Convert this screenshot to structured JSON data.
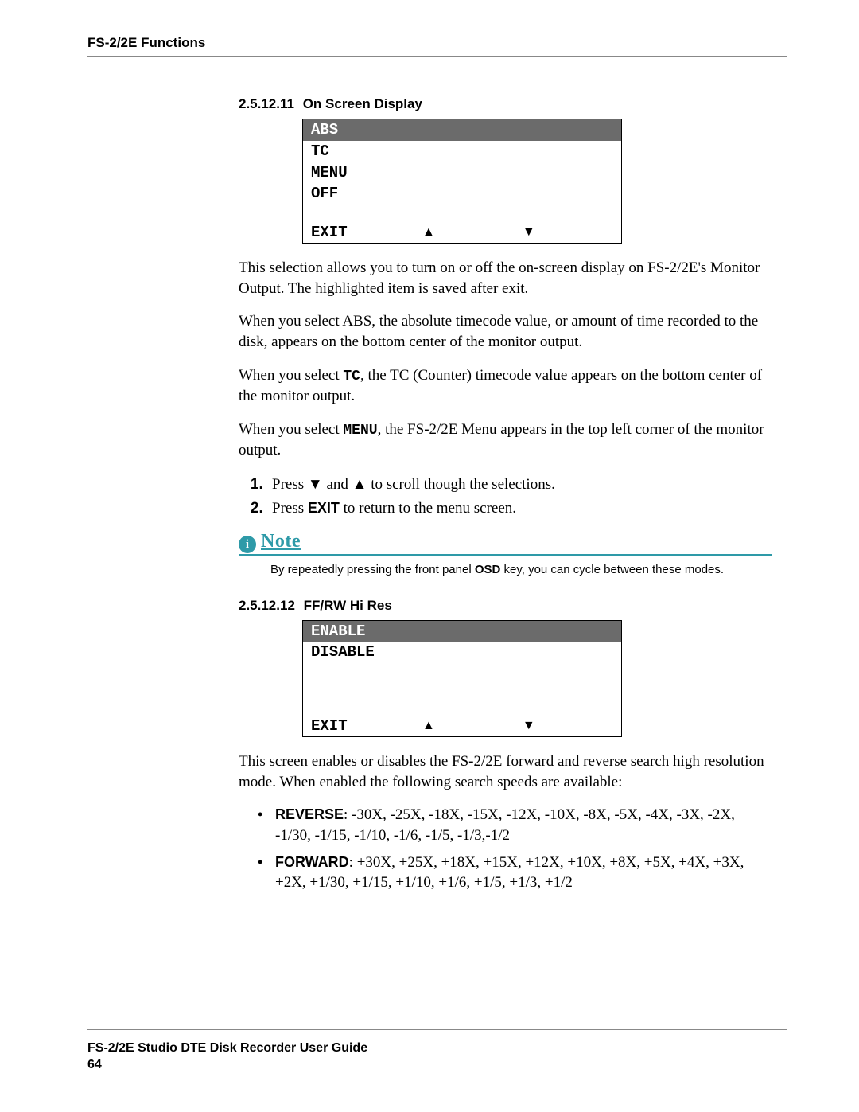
{
  "header": {
    "running_head": "FS-2/2E Functions"
  },
  "section1": {
    "number": "2.5.12.11",
    "title": "On Screen Display",
    "lcd": {
      "rows": [
        "ABS",
        "TC",
        "MENU",
        "OFF"
      ],
      "highlighted_index": 0,
      "exit_label": "EXIT",
      "arrow_up": "▲",
      "arrow_down": "▼"
    },
    "p1": "This selection allows you to turn on or off the on-screen display on FS-2/2E's Monitor Output. The highlighted item is saved after exit.",
    "p2": "When you select ABS, the absolute timecode value, or amount of time recorded to the disk, appears on the bottom center of the monitor output.",
    "p3_pre": "When you select ",
    "p3_bold": "TC",
    "p3_post": ", the TC (Counter) timecode value appears on the bottom center of the monitor output.",
    "p4_pre": "When you select ",
    "p4_bold": "MENU",
    "p4_post": ", the FS-2/2E Menu appears in the top left corner of the monitor output.",
    "step1_pre": "Press ",
    "step1_down": "▼",
    "step1_mid": " and ",
    "step1_up": "▲",
    "step1_post": " to scroll though the selections.",
    "step2_pre": "Press ",
    "step2_bold": "EXIT",
    "step2_post": " to return to the menu screen.",
    "note": {
      "label": "Note",
      "icon_char": "i",
      "text_pre": "By repeatedly pressing the front panel ",
      "text_bold": "OSD",
      "text_post": " key, you can cycle between these modes."
    }
  },
  "section2": {
    "number": "2.5.12.12",
    "title": "FF/RW Hi Res",
    "lcd": {
      "rows": [
        "ENABLE",
        "DISABLE"
      ],
      "highlighted_index": 0,
      "exit_label": "EXIT",
      "arrow_up": "▲",
      "arrow_down": "▼"
    },
    "p1": "This screen enables or disables the FS-2/2E forward and reverse search high resolution mode. When enabled the following search speeds are available:",
    "bullets": {
      "b1_label": "REVERSE",
      "b1_text": ": -30X, -25X, -18X, -15X, -12X, -10X, -8X, -5X, -4X, -3X, -2X, -1/30, -1/15, -1/10, -1/6, -1/5, -1/3,-1/2",
      "b2_label": "FORWARD",
      "b2_text": ": +30X, +25X, +18X, +15X, +12X, +10X, +8X, +5X, +4X, +3X, +2X, +1/30, +1/15, +1/10, +1/6, +1/5, +1/3, +1/2"
    }
  },
  "footer": {
    "guide_title": "FS-2/2E Studio DTE Disk Recorder User Guide",
    "page_number": "64"
  }
}
